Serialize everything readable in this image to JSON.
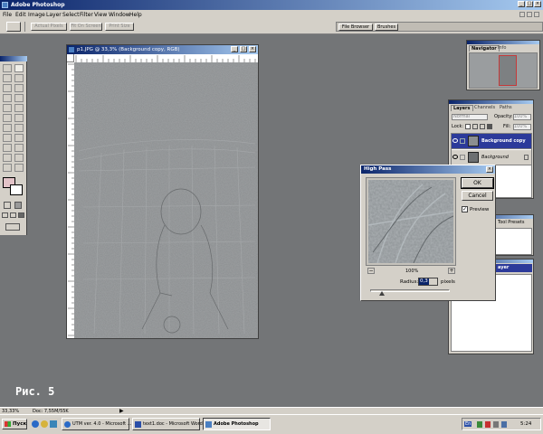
{
  "app": {
    "title": "Adobe Photoshop"
  },
  "menu": [
    "File",
    "Edit",
    "Image",
    "Layer",
    "Select",
    "Filter",
    "View",
    "Window",
    "Help"
  ],
  "options_bar": {
    "buttons": [
      "Actual Pixels",
      "Fit On Screen",
      "Print Size"
    ]
  },
  "palette_well": {
    "tabs": [
      "File Browser",
      "Brushes"
    ]
  },
  "document": {
    "title": "p1.JPG @ 33,3% (Background copy, RGB)"
  },
  "navigator": {
    "tabs": [
      "Navigator",
      "Info"
    ]
  },
  "layers": {
    "tabs": [
      "Layers",
      "Channels",
      "Paths"
    ],
    "blend_mode": "Normal",
    "opacity_label": "Opacity:",
    "opacity_value": "100%",
    "lock_label": "Lock:",
    "fill_label": "Fill:",
    "fill_value": "100%",
    "items": [
      {
        "name": "Background copy",
        "selected": true
      },
      {
        "name": "Background",
        "selected": false
      }
    ]
  },
  "history": {
    "tab_partial": "Tool Presets"
  },
  "styles": {
    "label_partial": "ayer"
  },
  "high_pass": {
    "title": "High Pass",
    "ok_label": "OK",
    "cancel_label": "Cancel",
    "preview_label": "Preview",
    "preview_checked": true,
    "zoom": "100%",
    "radius_label": "Radius:",
    "radius_value": "0,3",
    "unit": "pixels",
    "slider_level": 0.15
  },
  "status_bar": {
    "zoom": "33,33%",
    "doc": "Doc: 7,55M/55K"
  },
  "caption": "Рис. 5",
  "taskbar": {
    "start_label": "Пуск",
    "tasks": [
      "UTM ver. 4.0 - Microsoft ...",
      "text1.doc - Microsoft Word",
      "Adobe Photoshop"
    ],
    "clock": "5:24",
    "lang": "En"
  },
  "colors": {
    "desktop": "#737577",
    "titlebar": "#0a246a",
    "accent": "#0a246a",
    "selected_layer": "#2c3a9a"
  }
}
